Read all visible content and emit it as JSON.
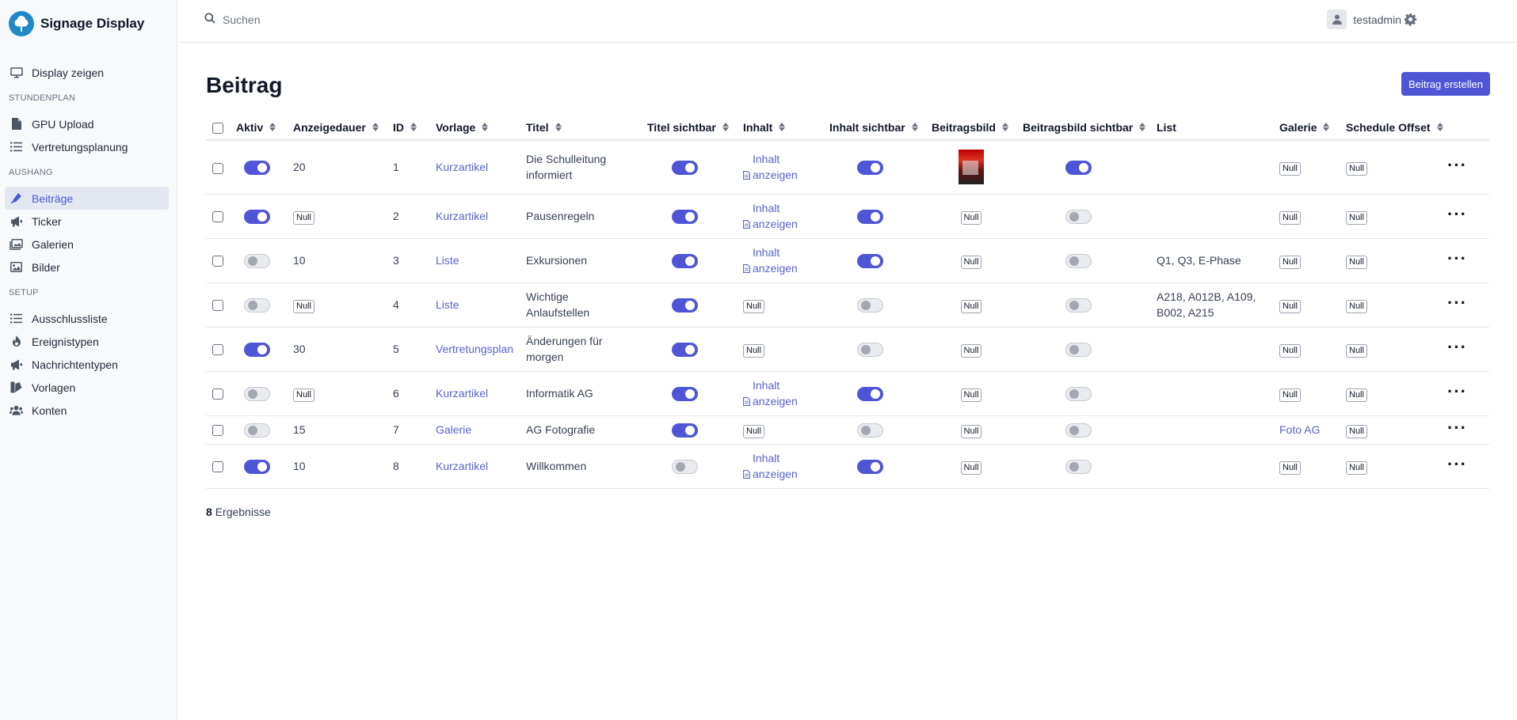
{
  "app": {
    "title": "Signage Display"
  },
  "search": {
    "placeholder": "Suchen"
  },
  "user": {
    "name": "testadmin"
  },
  "sidebar": {
    "top": [
      {
        "label": "Display zeigen",
        "icon": "monitor-icon"
      }
    ],
    "sections": [
      {
        "title": "Stundenplan",
        "items": [
          {
            "label": "GPU Upload",
            "icon": "file-icon"
          },
          {
            "label": "Vertretungsplanung",
            "icon": "list-icon"
          }
        ]
      },
      {
        "title": "Aushang",
        "items": [
          {
            "label": "Beiträge",
            "icon": "pen-icon",
            "active": true
          },
          {
            "label": "Ticker",
            "icon": "megaphone-icon"
          },
          {
            "label": "Galerien",
            "icon": "images-icon"
          },
          {
            "label": "Bilder",
            "icon": "image-icon"
          }
        ]
      },
      {
        "title": "Setup",
        "items": [
          {
            "label": "Ausschlussliste",
            "icon": "list-icon"
          },
          {
            "label": "Ereignistypen",
            "icon": "fire-icon"
          },
          {
            "label": "Nachrichtentypen",
            "icon": "megaphone-icon"
          },
          {
            "label": "Vorlagen",
            "icon": "palette-icon"
          },
          {
            "label": "Konten",
            "icon": "users-icon"
          }
        ]
      }
    ]
  },
  "page": {
    "title": "Beitrag",
    "create_label": "Beitrag erstellen"
  },
  "table": {
    "headers": [
      "Aktiv",
      "Anzeigedauer",
      "ID",
      "Vorlage",
      "Titel",
      "Titel sichtbar",
      "Inhalt",
      "Inhalt sichtbar",
      "Beitragsbild",
      "Beitragsbild sichtbar",
      "List",
      "Galerie",
      "Schedule Offset"
    ],
    "null_label": "Null",
    "content_link_label": "Inhalt anzeigen",
    "rows": [
      {
        "aktiv": true,
        "dauer": "20",
        "id": "1",
        "vorlage": "Kurzartikel",
        "titel": "Die Schulleitung informiert",
        "titel_sichtbar": true,
        "inhalt": true,
        "inhalt_sichtbar": true,
        "bild": "image",
        "bild_sichtbar": true,
        "list": "",
        "galerie": null,
        "offset": null
      },
      {
        "aktiv": true,
        "dauer": null,
        "id": "2",
        "vorlage": "Kurzartikel",
        "titel": "Pausenregeln",
        "titel_sichtbar": true,
        "inhalt": true,
        "inhalt_sichtbar": true,
        "bild": null,
        "bild_sichtbar": false,
        "list": "",
        "galerie": null,
        "offset": null
      },
      {
        "aktiv": false,
        "dauer": "10",
        "id": "3",
        "vorlage": "Liste",
        "titel": "Exkursionen",
        "titel_sichtbar": true,
        "inhalt": true,
        "inhalt_sichtbar": true,
        "bild": null,
        "bild_sichtbar": false,
        "list": "Q1, Q3, E-Phase",
        "galerie": null,
        "offset": null
      },
      {
        "aktiv": false,
        "dauer": null,
        "id": "4",
        "vorlage": "Liste",
        "titel": "Wichtige Anlaufstellen",
        "titel_sichtbar": true,
        "inhalt": null,
        "inhalt_sichtbar": false,
        "bild": null,
        "bild_sichtbar": false,
        "list": "A218, A012B, A109, B002, A215",
        "galerie": null,
        "offset": null
      },
      {
        "aktiv": true,
        "dauer": "30",
        "id": "5",
        "vorlage": "Vertretungsplan",
        "titel": "Änderungen für morgen",
        "titel_sichtbar": true,
        "inhalt": null,
        "inhalt_sichtbar": false,
        "bild": null,
        "bild_sichtbar": false,
        "list": "",
        "galerie": null,
        "offset": null
      },
      {
        "aktiv": false,
        "dauer": null,
        "id": "6",
        "vorlage": "Kurzartikel",
        "titel": "Informatik AG",
        "titel_sichtbar": true,
        "inhalt": true,
        "inhalt_sichtbar": true,
        "bild": null,
        "bild_sichtbar": false,
        "list": "",
        "galerie": null,
        "offset": null
      },
      {
        "aktiv": false,
        "dauer": "15",
        "id": "7",
        "vorlage": "Galerie",
        "titel": "AG Fotografie",
        "titel_sichtbar": true,
        "inhalt": null,
        "inhalt_sichtbar": false,
        "bild": null,
        "bild_sichtbar": false,
        "list": "",
        "galerie": "Foto AG",
        "offset": null
      },
      {
        "aktiv": true,
        "dauer": "10",
        "id": "8",
        "vorlage": "Kurzartikel",
        "titel": "Willkommen",
        "titel_sichtbar": false,
        "inhalt": true,
        "inhalt_sichtbar": true,
        "bild": null,
        "bild_sichtbar": false,
        "list": "",
        "galerie": null,
        "offset": null
      }
    ]
  },
  "results": {
    "count": "8",
    "label": "Ergebnisse"
  },
  "colors": {
    "accent": "#5055d6",
    "link": "#5a63c9",
    "logo": "#1e88c8"
  }
}
